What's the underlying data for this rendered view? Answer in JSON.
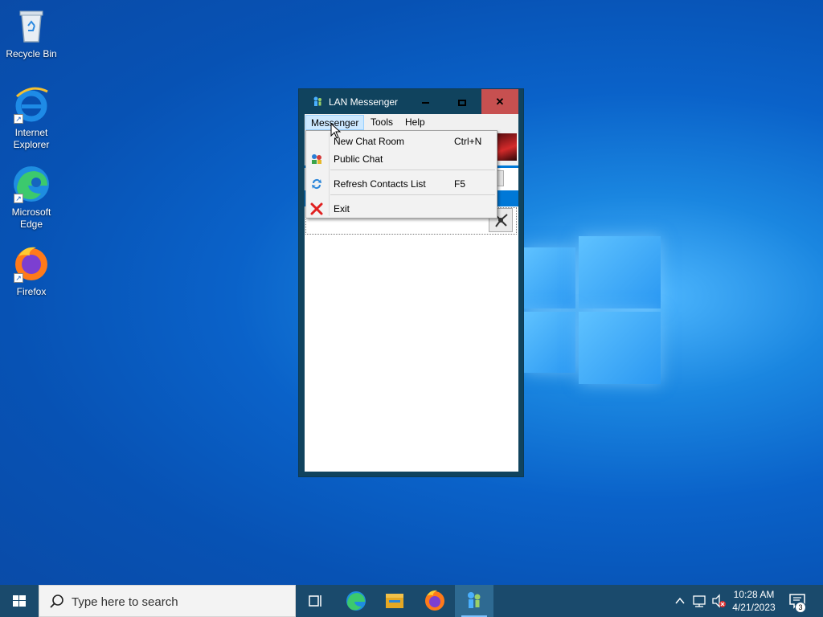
{
  "desktop": {
    "icons": [
      {
        "label": "Recycle Bin",
        "icon": "recycle-bin-icon"
      },
      {
        "label": "Internet Explorer",
        "icon": "internet-explorer-icon"
      },
      {
        "label": "Microsoft Edge",
        "icon": "edge-icon"
      },
      {
        "label": "Firefox",
        "icon": "firefox-icon"
      }
    ]
  },
  "window": {
    "title": "LAN Messenger",
    "controls": {
      "minimize": "minimize-icon",
      "maximize": "maximize-icon",
      "close": "close-icon"
    },
    "menu": [
      {
        "label": "Messenger",
        "active": true
      },
      {
        "label": "Tools"
      },
      {
        "label": "Help"
      }
    ],
    "dropdown": {
      "items": [
        {
          "label": "New Chat Room",
          "shortcut": "Ctrl+N",
          "icon": ""
        },
        {
          "label": "Public Chat",
          "shortcut": "",
          "icon": "public-chat-icon"
        },
        {
          "label": "Refresh Contacts List",
          "shortcut": "F5",
          "icon": "refresh-icon"
        },
        {
          "label": "Exit",
          "shortcut": "",
          "icon": "exit-x-icon"
        }
      ]
    },
    "colors": {
      "accent": "#0078d7",
      "titlebar": "#10435e",
      "close_hover": "#c75050"
    }
  },
  "taskbar": {
    "search_placeholder": "Type here to search",
    "apps": [
      "task-view-icon",
      "edge-icon",
      "file-explorer-icon",
      "firefox-icon",
      "lan-messenger-icon"
    ],
    "clock": {
      "time": "10:28 AM",
      "date": "4/21/2023"
    },
    "notifications": "3"
  }
}
